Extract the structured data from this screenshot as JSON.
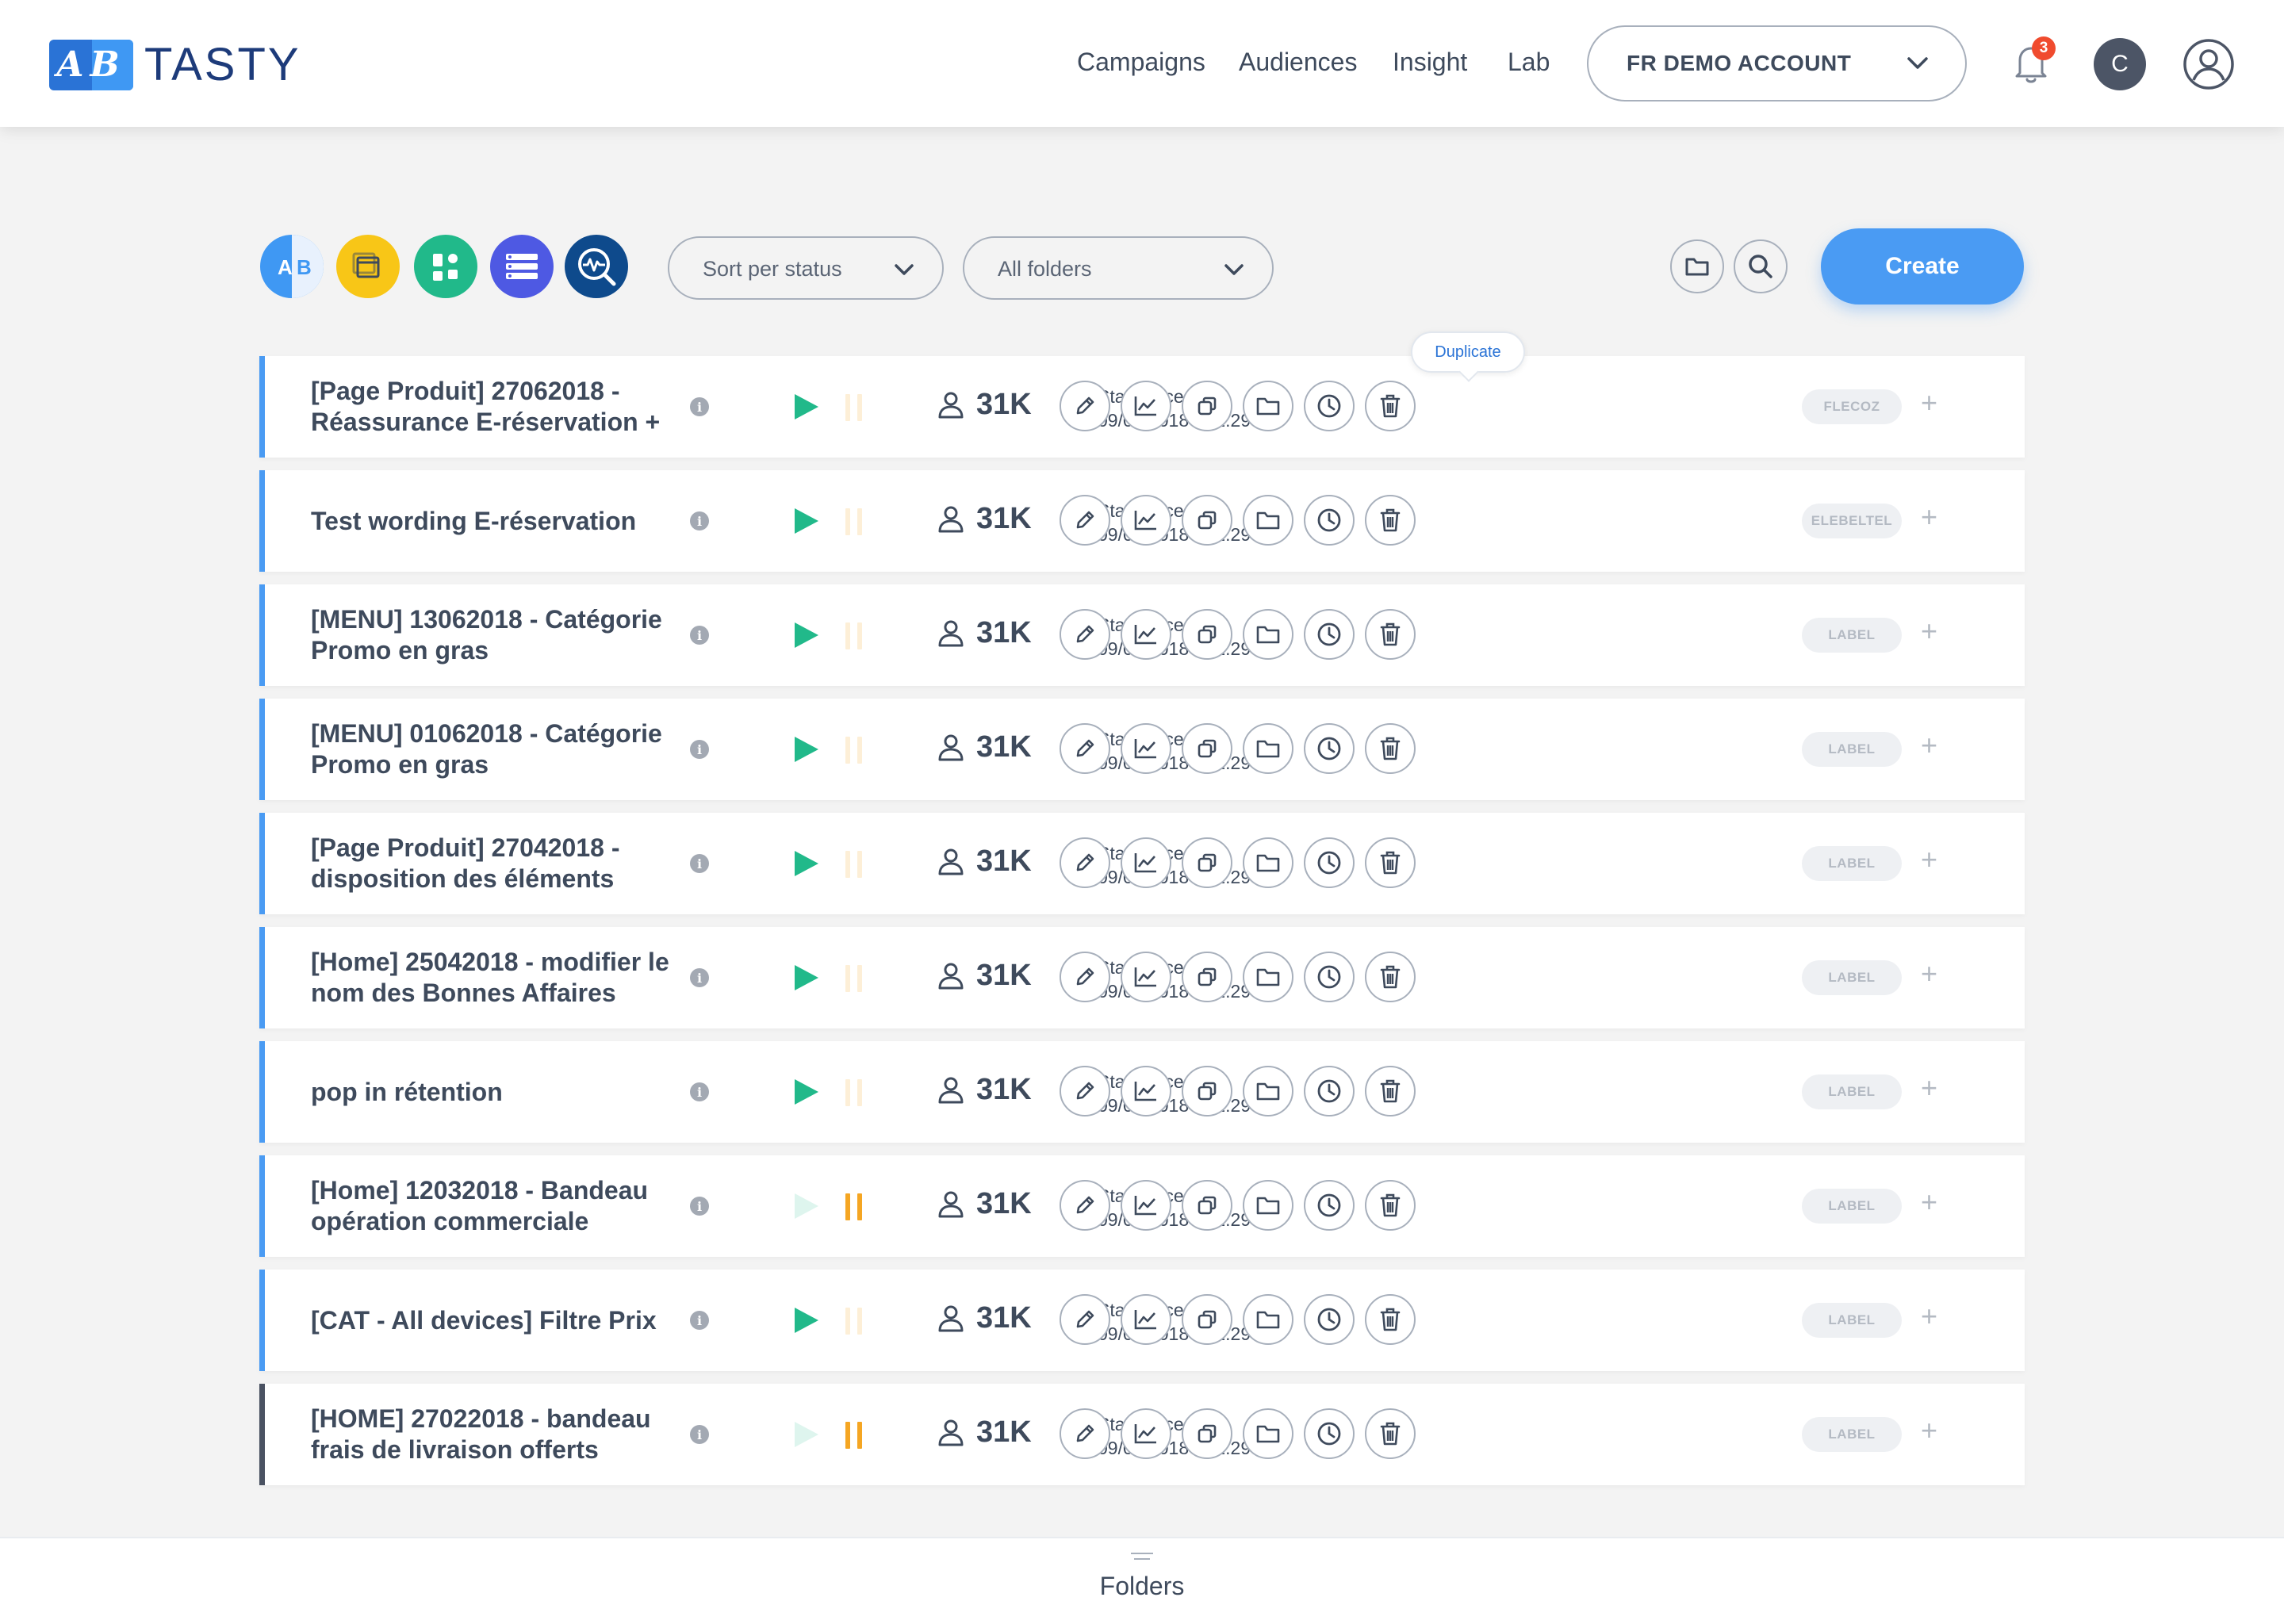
{
  "brand": {
    "logo_letters": "AB",
    "name": "TASTY",
    "blue_dark": "#2a73d6",
    "blue_light": "#3f98f3"
  },
  "nav": [
    {
      "label": "Campaigns"
    },
    {
      "label": "Audiences"
    },
    {
      "label": "Insight"
    },
    {
      "label": "Lab"
    }
  ],
  "account": {
    "label": "FR DEMO ACCOUNT"
  },
  "notifications": {
    "count": "3"
  },
  "profile": {
    "initial": "C"
  },
  "toolbar": {
    "type_filters": [
      {
        "icon": "ab-test-icon",
        "letters_a": "A",
        "letters_b": "B",
        "color": "#3f98f3"
      },
      {
        "icon": "windows-icon",
        "color": "#f8c617"
      },
      {
        "icon": "widgets-icon",
        "color": "#21b98a"
      },
      {
        "icon": "list-icon",
        "color": "#4e59e3"
      },
      {
        "icon": "performance-icon",
        "color": "#0e4a8c"
      }
    ],
    "sort_label": "Sort per status",
    "folder_label": "All folders",
    "create_label": "Create"
  },
  "tooltip": {
    "label": "Duplicate"
  },
  "campaigns": [
    {
      "name": "[Page Produit] 27062018 - Réassurance E-réservation +",
      "status": "running",
      "traffic": "31K",
      "since_label": "Start since :",
      "since_date": "09/07/2018 - 12:29",
      "label": "FLECOZ"
    },
    {
      "name": "Test wording E-réservation",
      "status": "running",
      "traffic": "31K",
      "since_label": "Start since :",
      "since_date": "09/07/2018 - 12:29",
      "label": "ELEBELTEL"
    },
    {
      "name": "[MENU] 13062018 - Catégorie Promo en gras",
      "status": "running",
      "traffic": "31K",
      "since_label": "Start since :",
      "since_date": "09/07/2018 - 12:29",
      "label": "LABEL"
    },
    {
      "name": "[MENU] 01062018 - Catégorie Promo en gras",
      "status": "running",
      "traffic": "31K",
      "since_label": "Start since :",
      "since_date": "09/07/2018 - 12:29",
      "label": "LABEL"
    },
    {
      "name": "[Page Produit] 27042018 - disposition des éléments",
      "status": "running",
      "traffic": "31K",
      "since_label": "Start since :",
      "since_date": "09/07/2018 - 12:29",
      "label": "LABEL"
    },
    {
      "name": "[Home] 25042018 - modifier le nom des Bonnes Affaires",
      "status": "running",
      "traffic": "31K",
      "since_label": "Start since :",
      "since_date": "09/07/2018 - 12:29",
      "label": "LABEL"
    },
    {
      "name": "pop in rétention",
      "status": "running",
      "traffic": "31K",
      "since_label": "Start since :",
      "since_date": "09/07/2018 - 12:29",
      "label": "LABEL"
    },
    {
      "name": "[Home] 12032018 - Bandeau opération commerciale",
      "status": "paused",
      "traffic": "31K",
      "since_label": "Start since :",
      "since_date": "09/07/2018 - 12:29",
      "label": "LABEL"
    },
    {
      "name": "[CAT - All devices] Filtre Prix",
      "status": "running",
      "traffic": "31K",
      "since_label": "Start since :",
      "since_date": "09/07/2018 - 12:29",
      "label": "LABEL"
    },
    {
      "name": "[HOME] 27022018 - bandeau frais de livraison offerts",
      "status": "paused",
      "traffic": "31K",
      "since_label": "Start since :",
      "since_date": "09/07/2018 - 12:29",
      "label": "LABEL"
    }
  ],
  "row_actions": [
    "edit-icon",
    "report-icon",
    "duplicate-icon",
    "folder-icon",
    "history-icon",
    "delete-icon"
  ],
  "status_colors": {
    "play": "#21b98a",
    "pause": "#f5a623"
  },
  "footer": {
    "label": "Folders"
  }
}
